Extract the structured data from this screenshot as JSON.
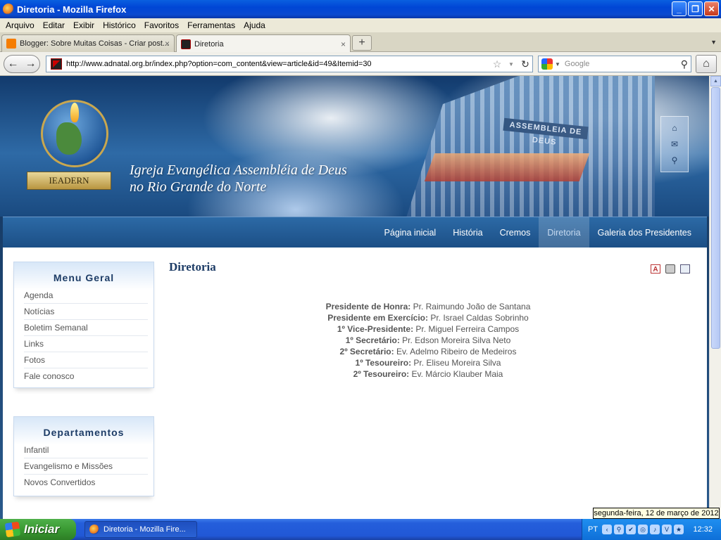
{
  "window": {
    "title": "Diretoria - Mozilla Firefox"
  },
  "menubar": {
    "items": [
      "Arquivo",
      "Editar",
      "Exibir",
      "Histórico",
      "Favoritos",
      "Ferramentas",
      "Ajuda"
    ]
  },
  "tabs": [
    {
      "label": "Blogger: Sobre Muitas Coisas - Criar post...",
      "active": false
    },
    {
      "label": "Diretoria",
      "active": true
    }
  ],
  "navbar": {
    "url": "http://www.adnatal.org.br/index.php?option=com_content&view=article&id=49&Itemid=30",
    "search_placeholder": "Google"
  },
  "site": {
    "church_name_line1": "Igreja Evangélica Assembléia de Deus",
    "church_name_line2": "no Rio Grande do Norte",
    "logo_ribbon": "IEADERN",
    "building_sign": "ASSEMBLEIA DE DEUS",
    "nav": [
      {
        "label": "Página inicial",
        "active": false
      },
      {
        "label": "História",
        "active": false
      },
      {
        "label": "Cremos",
        "active": false
      },
      {
        "label": "Diretoria",
        "active": true
      },
      {
        "label": "Galeria dos Presidentes",
        "active": false
      }
    ]
  },
  "sidebar": {
    "menu_geral": {
      "title": "Menu Geral",
      "items": [
        "Agenda",
        "Notícias",
        "Boletim Semanal",
        "Links",
        "Fotos",
        "Fale conosco"
      ]
    },
    "departamentos": {
      "title": "Departamentos",
      "items": [
        "Infantil",
        "Evangelismo e Missões",
        "Novos Convertidos"
      ]
    }
  },
  "article": {
    "title": "Diretoria",
    "board": [
      {
        "role": "Presidente de Honra:",
        "name": "Pr. Raimundo João de Santana"
      },
      {
        "role": "Presidente em Exercício:",
        "name": "Pr. Israel Caldas Sobrinho"
      },
      {
        "role": "1º Vice-Presidente:",
        "name": "Pr. Miguel Ferreira Campos"
      },
      {
        "role": "1º Secretário:",
        "name": "Pr. Edson Moreira Silva Neto"
      },
      {
        "role": "2º Secretário:",
        "name": "Ev. Adelmo Ribeiro de Medeiros"
      },
      {
        "role": "1º Tesoureiro:",
        "name": "Pr. Eliseu Moreira Silva"
      },
      {
        "role": "2º Tesoureiro:",
        "name": "Ev. Márcio Klauber Maia"
      }
    ]
  },
  "tooltip": "segunda-feira, 12 de março de 2012",
  "taskbar": {
    "start_label": "Iniciar",
    "task_label": "Diretoria - Mozilla Fire...",
    "lang": "PT",
    "clock": "12:32"
  }
}
